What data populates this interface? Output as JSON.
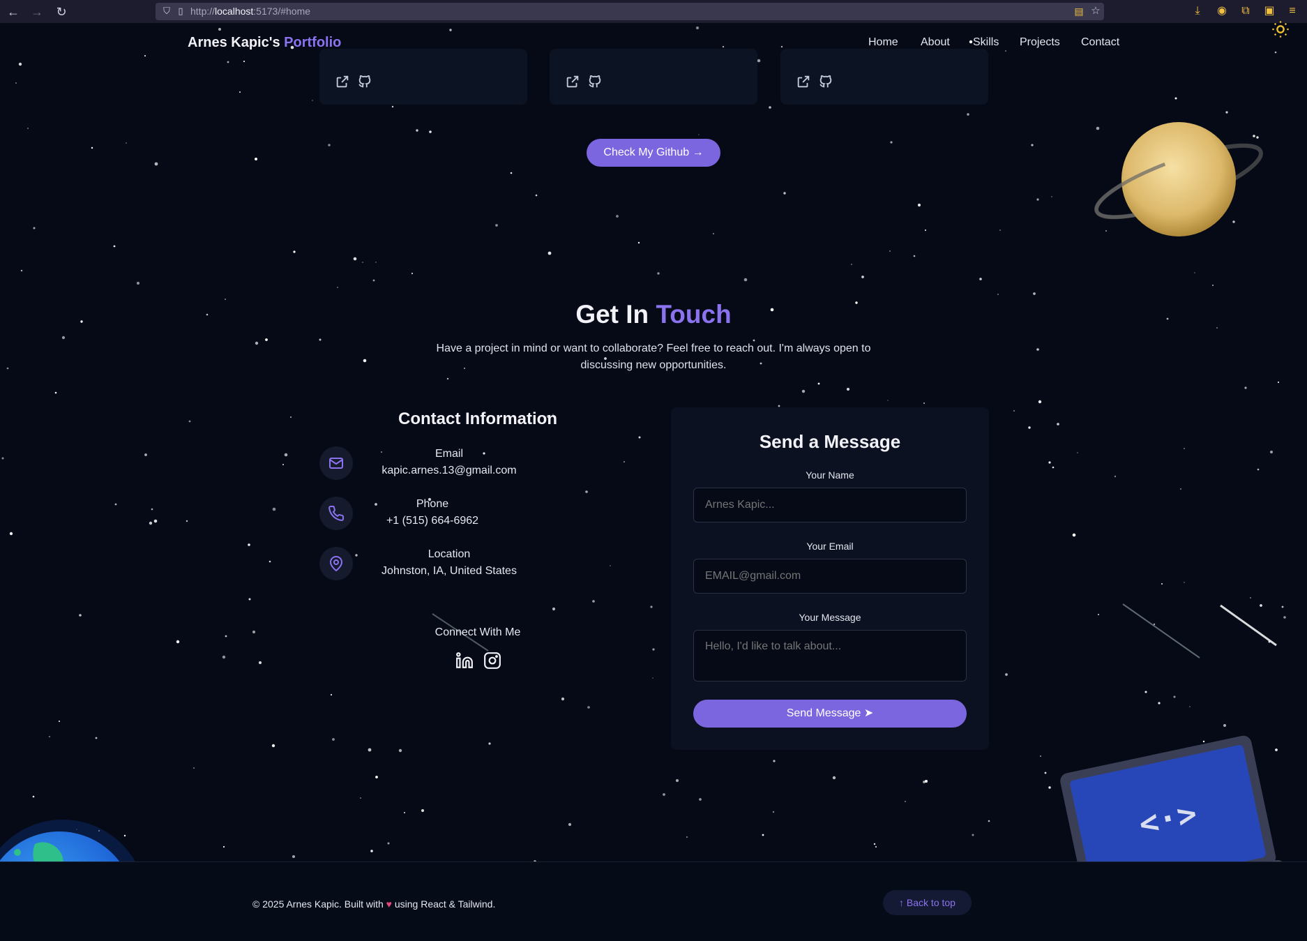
{
  "browser": {
    "url_scheme": "http://",
    "url_host": "localhost",
    "url_rest": ":5173/#home"
  },
  "header": {
    "brand_main": "Arnes Kapic's",
    "brand_accent": "Portfolio",
    "nav": [
      "Home",
      "About",
      "Skills",
      "Projects",
      "Contact"
    ]
  },
  "projects": {
    "github_button": "Check My Github"
  },
  "contact": {
    "title_main": "Get In",
    "title_accent": "Touch",
    "subtitle": "Have a project in mind or want to collaborate? Feel free to reach out. I'm always open to discussing new opportunities.",
    "info_heading": "Contact Information",
    "items": [
      {
        "label": "Email",
        "value": "kapic.arnes.13@gmail.com",
        "icon": "mail-icon"
      },
      {
        "label": "Phone",
        "value": "+1 (515) 664-6962",
        "icon": "phone-icon"
      },
      {
        "label": "Location",
        "value": "Johnston, IA, United States",
        "icon": "location-pin-icon"
      }
    ],
    "connect_title": "Connect With Me",
    "socials": [
      "linkedin-icon",
      "instagram-icon"
    ]
  },
  "form": {
    "title": "Send a Message",
    "name_label": "Your Name",
    "name_placeholder": "Arnes Kapic...",
    "email_label": "Your Email",
    "email_placeholder": "EMAIL@gmail.com",
    "message_label": "Your Message",
    "message_placeholder": "Hello, I'd like to talk about...",
    "submit": "Send Message"
  },
  "footer": {
    "copyright_before": "© 2025 Arnes Kapic. Built with",
    "copyright_after": "using React & Tailwind.",
    "back_to_top": "Back to top"
  },
  "colors": {
    "accent": "#8b73f0",
    "button": "#7c66e0",
    "background": "#050a16",
    "card": "#0b1121"
  }
}
